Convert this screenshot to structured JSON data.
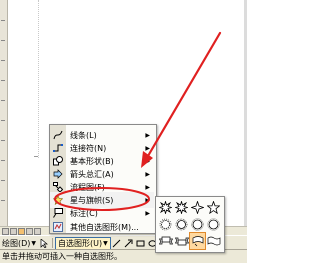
{
  "drawing_toolbar": {
    "draw_label": "绘图(D)",
    "autoshapes_label": "自选图形(U)",
    "cursor_icon": "select-arrow-icon"
  },
  "status": {
    "text": "单击并拖动可插入一种自选图形。"
  },
  "autoshapes_menu": {
    "items": [
      {
        "label": "线条(L)",
        "icon": "lines-icon",
        "has_submenu": true
      },
      {
        "label": "连接符(N)",
        "icon": "connectors-icon",
        "has_submenu": true
      },
      {
        "label": "基本形状(B)",
        "icon": "basic-shapes-icon",
        "has_submenu": true
      },
      {
        "label": "箭头总汇(A)",
        "icon": "block-arrows-icon",
        "has_submenu": true
      },
      {
        "label": "流程图(F)",
        "icon": "flowchart-icon",
        "has_submenu": true
      },
      {
        "label": "星与旗帜(S)",
        "icon": "stars-banners-icon",
        "has_submenu": true,
        "active": true
      },
      {
        "label": "标注(C)",
        "icon": "callouts-icon",
        "has_submenu": true
      },
      {
        "label": "其他自选图形(M)...",
        "icon": "more-autoshapes-icon",
        "has_submenu": false
      }
    ]
  },
  "stars_submenu": {
    "shapes": [
      "explosion-1",
      "explosion-2",
      "star-4",
      "star-5",
      "star-8",
      "star-16",
      "star-24",
      "star-32",
      "up-ribbon",
      "down-ribbon",
      "curved-ribbon",
      "wave"
    ],
    "highlight_color": "#ffd9a0"
  },
  "annotation": {
    "arrow_color": "#e02020",
    "circle_color": "#e02020"
  }
}
